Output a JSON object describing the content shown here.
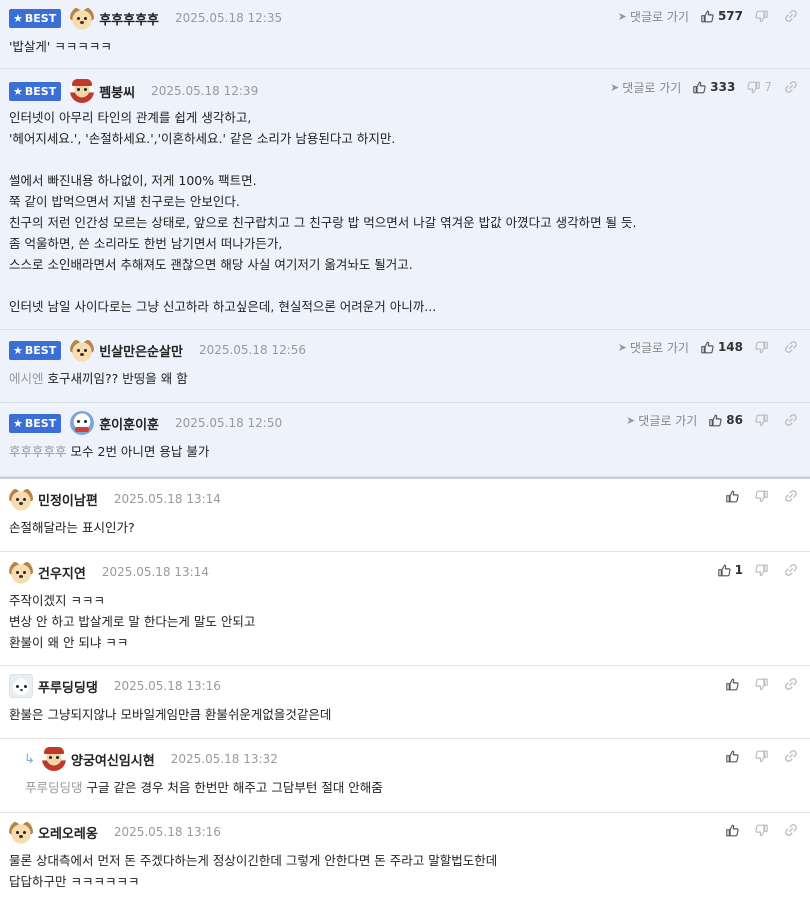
{
  "best_label": "BEST",
  "goto_label": "댓글로 가기",
  "comments": [
    {
      "badge": true,
      "avatar": "puppy-avatar",
      "nick": "후후후후후",
      "date": "2025.05.18 12:35",
      "up": "577",
      "down": "",
      "goto": true,
      "mention": "",
      "body": "'밥살게' ㅋㅋㅋㅋㅋ"
    },
    {
      "badge": true,
      "avatar": "hero-avatar",
      "nick": "펨붕씨",
      "date": "2025.05.18 12:39",
      "up": "333",
      "down": "7",
      "goto": true,
      "mention": "",
      "body": "인터넷이 아무리 타인의 관계를 쉽게 생각하고,\n'헤어지세요.', '손절하세요.','이혼하세요.' 같은 소리가 남용된다고 하지만.\n\n썰에서 빠진내용 하나없이, 저게 100% 팩트면.\n쭉 같이 밥먹으면서 지낼 친구로는 안보인다.\n친구의 저런 인간성 모르는 상태로, 앞으로 친구랍치고 그 친구랑 밥 먹으면서 나갈 엮겨운 밥값 아꼈다고 생각하면 될 듯.\n좀 억울하면, 쓴 소리라도 한번 남기면서 떠나가든가,\n스스로 소인배라면서 추해져도 괜찮으면 해당 사실 여기저기 옮겨놔도 될거고.\n\n인터넷 남일 사이다로는 그냥 신고하라 하고싶은데, 현실적으론 어려운거 아니까..."
    },
    {
      "badge": true,
      "avatar": "puppy-avatar",
      "nick": "빈살만은순살만",
      "date": "2025.05.18 12:56",
      "up": "148",
      "down": "",
      "goto": true,
      "mention": "에시엔",
      "body": "호구새끼임?? 반띵을 왜 함"
    },
    {
      "badge": true,
      "avatar": "snowman-avatar",
      "nick": "훈이훈이훈",
      "date": "2025.05.18 12:50",
      "up": "86",
      "down": "",
      "goto": true,
      "mention": "후후후후후",
      "body": "모수 2번 아니면 용납 불가"
    },
    {
      "badge": false,
      "avatar": "puppy-avatar",
      "nick": "민정이남편",
      "date": "2025.05.18 13:14",
      "up": "",
      "down": "",
      "goto": false,
      "mention": "",
      "body": "손절해달라는 표시인가?"
    },
    {
      "badge": false,
      "avatar": "puppy-avatar",
      "nick": "건우지연",
      "date": "2025.05.18 13:14",
      "up": "1",
      "down": "",
      "goto": false,
      "mention": "",
      "body": "주작이겠지 ㅋㅋㅋ\n변상 안 하고 밥살게로 말 한다는게 말도 안되고\n환불이 왜 안 되냐 ㅋㅋ"
    },
    {
      "badge": false,
      "avatar": "white-dog-avatar",
      "nick": "푸루딩딩댕",
      "date": "2025.05.18 13:16",
      "up": "",
      "down": "",
      "goto": false,
      "mention": "",
      "body": "환불은 그냥되지않나 모바일게임만큼 환불쉬운게없을것같은데"
    },
    {
      "badge": false,
      "reply": true,
      "avatar": "hero-avatar",
      "nick": "양궁여신임시현",
      "date": "2025.05.18 13:32",
      "up": "",
      "down": "",
      "goto": false,
      "mention": "푸루딩딩댕",
      "body": "구글 같은 경우 처음 한번만 해주고 그담부턴 절대 안해줌"
    },
    {
      "badge": false,
      "avatar": "puppy-avatar",
      "nick": "오레오레옹",
      "date": "2025.05.18 13:16",
      "up": "",
      "down": "",
      "goto": false,
      "mention": "",
      "body": "물론 상대측에서 먼저 돈 주겠다하는게 정상이긴한데 그렇게 안한다면 돈 주라고 말할법도한데\n답답하구만 ㅋㅋㅋㅋㅋㅋ"
    }
  ]
}
